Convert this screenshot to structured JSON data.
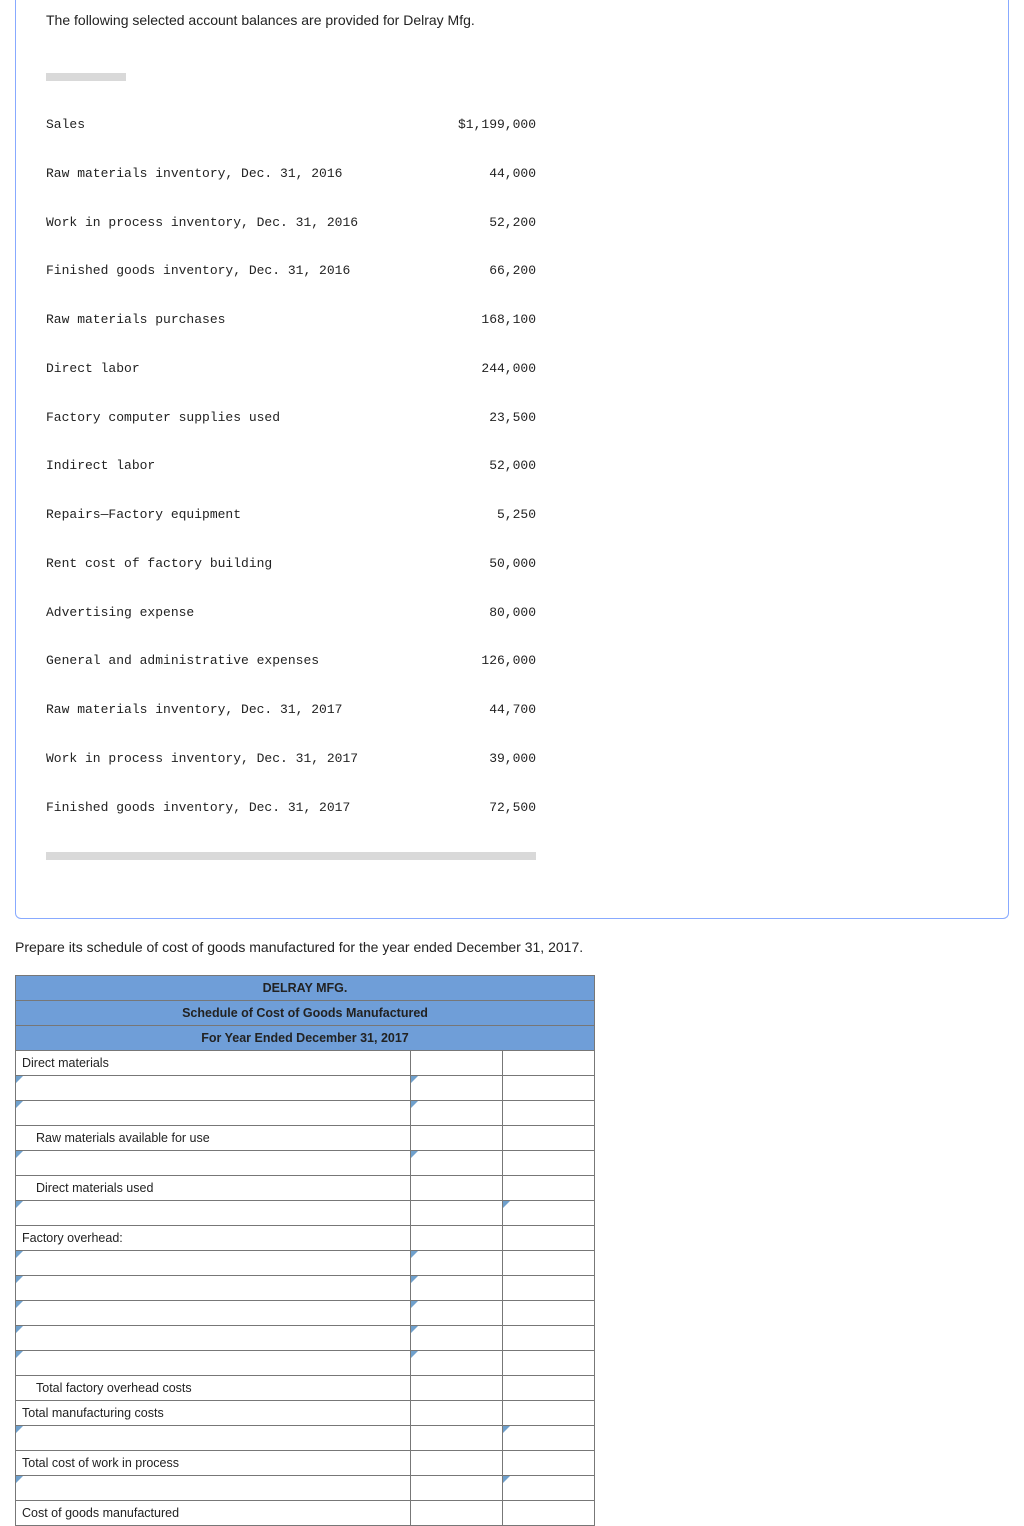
{
  "intro": "The following selected account balances are provided for Delray Mfg.",
  "balances": [
    {
      "label": "Sales",
      "amount": "$1,199,000"
    },
    {
      "label": "Raw materials inventory, Dec. 31, 2016",
      "amount": "44,000"
    },
    {
      "label": "Work in process inventory, Dec. 31, 2016",
      "amount": "52,200"
    },
    {
      "label": "Finished goods inventory, Dec. 31, 2016",
      "amount": "66,200"
    },
    {
      "label": "Raw materials purchases",
      "amount": "168,100"
    },
    {
      "label": "Direct labor",
      "amount": "244,000"
    },
    {
      "label": "Factory computer supplies used",
      "amount": "23,500"
    },
    {
      "label": "Indirect labor",
      "amount": "52,000"
    },
    {
      "label": "Repairs—Factory equipment",
      "amount": "5,250"
    },
    {
      "label": "Rent cost of factory building",
      "amount": "50,000"
    },
    {
      "label": "Advertising expense",
      "amount": "80,000"
    },
    {
      "label": "General and administrative expenses",
      "amount": "126,000"
    },
    {
      "label": "Raw materials inventory, Dec. 31, 2017",
      "amount": "44,700"
    },
    {
      "label": "Work in process inventory, Dec. 31, 2017",
      "amount": "39,000"
    },
    {
      "label": "Finished goods inventory, Dec. 31, 2017",
      "amount": "72,500"
    }
  ],
  "instruction": "Prepare its schedule of cost of goods manufactured for the year ended December 31, 2017.",
  "schedule": {
    "header1": "DELRAY MFG.",
    "header2": "Schedule of Cost of Goods Manufactured",
    "header3": "For Year Ended December 31, 2017",
    "rows": {
      "direct_materials": "Direct materials",
      "raw_avail": "Raw materials available for use",
      "dm_used": "Direct materials used",
      "fo": "Factory overhead:",
      "tot_fo": "Total factory overhead costs",
      "tot_mfg": "Total manufacturing costs",
      "tot_wip": "Total cost of work in process",
      "cogm": "Cost of goods manufactured"
    }
  }
}
